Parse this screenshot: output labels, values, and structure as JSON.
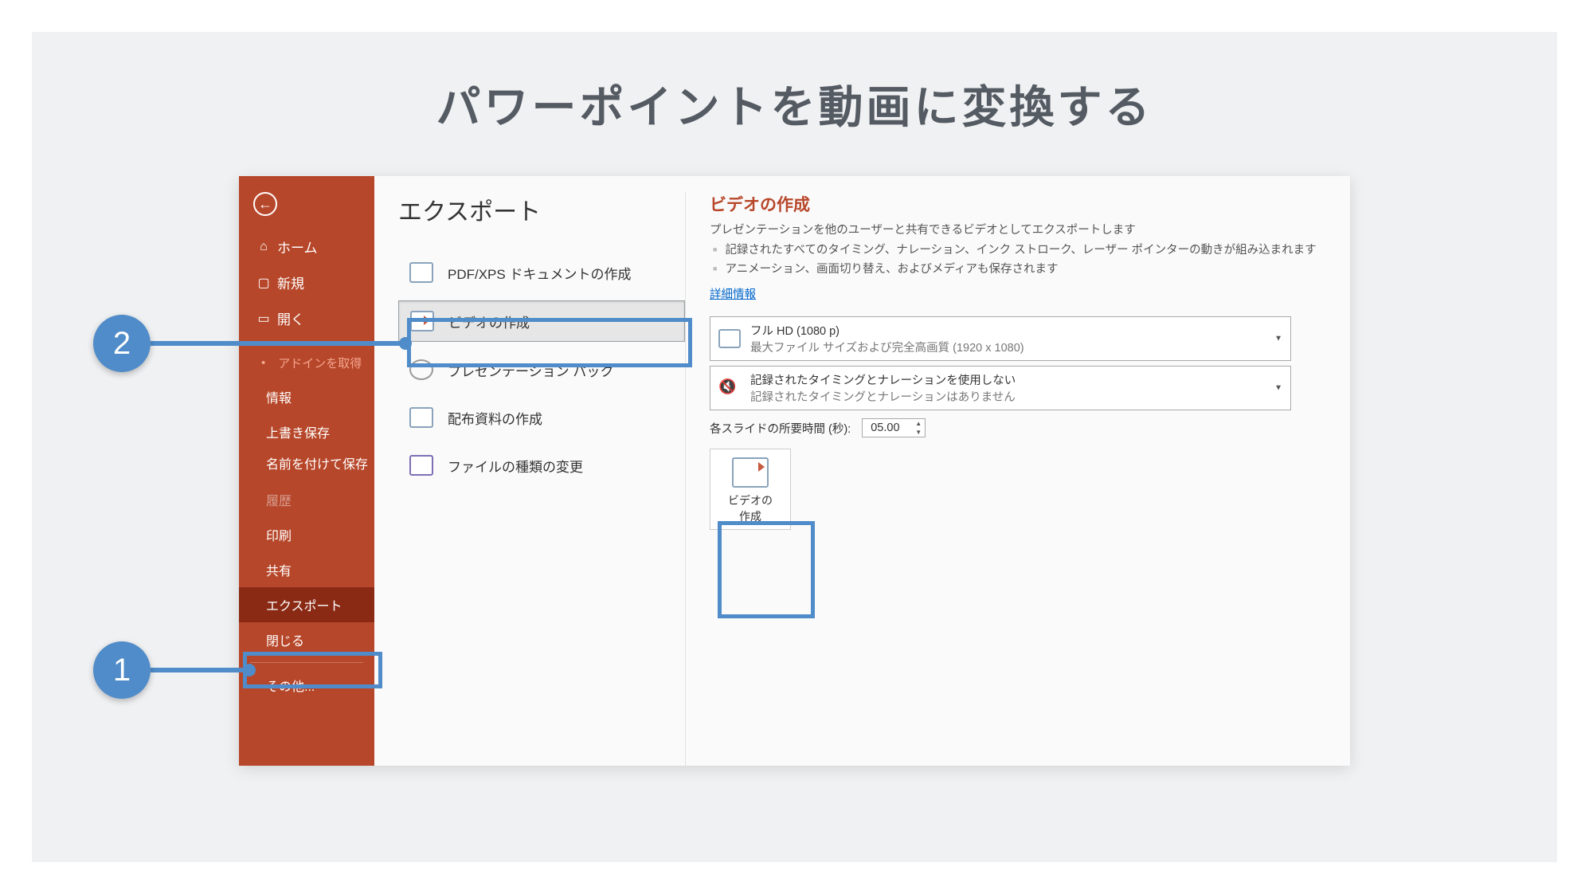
{
  "slide": {
    "title": "パワーポイントを動画に変換する"
  },
  "callouts": {
    "one": "1",
    "two": "2"
  },
  "sidebar": {
    "home": "ホーム",
    "new": "新規",
    "open": "開く",
    "addin": "アドインを取得",
    "info": "情報",
    "save": "上書き保存",
    "saveas": "名前を付けて保存",
    "history": "履歴",
    "print": "印刷",
    "share": "共有",
    "export": "エクスポート",
    "close": "閉じる",
    "other": "その他..."
  },
  "export": {
    "heading": "エクスポート",
    "items": {
      "pdf": "PDF/XPS ドキュメントの作成",
      "video": "ビデオの作成",
      "pack": "プレゼンテーション パック",
      "handout": "配布資料の作成",
      "filetype": "ファイルの種類の変更"
    }
  },
  "detail": {
    "title": "ビデオの作成",
    "desc": "プレゼンテーションを他のユーザーと共有できるビデオとしてエクスポートします",
    "b1": "記録されたすべてのタイミング、ナレーション、インク ストローク、レーザー ポインターの動きが組み込まれます",
    "b2": "アニメーション、画面切り替え、およびメディアも保存されます",
    "link": "詳細情報",
    "quality": {
      "line1": "フル HD (1080 p)",
      "line2": "最大ファイル サイズおよび完全高画質 (1920 x 1080)"
    },
    "narration": {
      "line1": "記録されたタイミングとナレーションを使用しない",
      "line2": "記録されたタイミングとナレーションはありません"
    },
    "timing_label": "各スライドの所要時間 (秒):",
    "timing_value": "05.00",
    "button_l1": "ビデオの",
    "button_l2": "作成"
  }
}
